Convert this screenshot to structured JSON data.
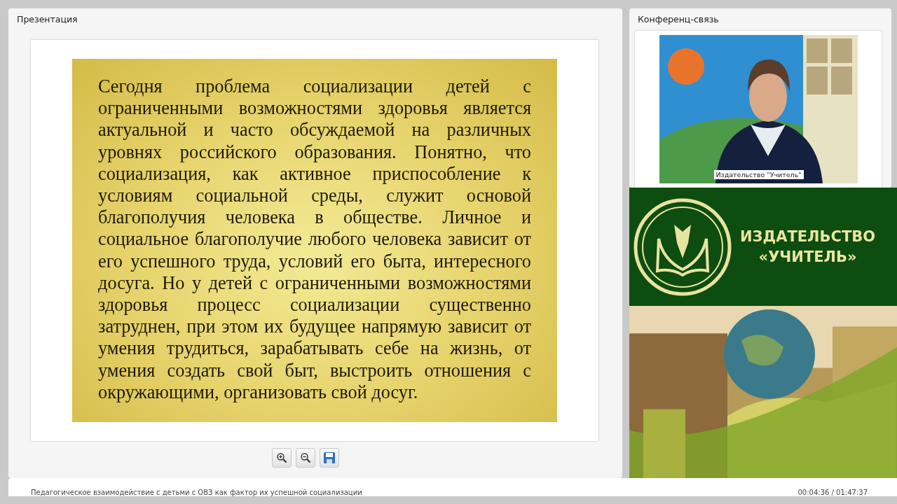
{
  "presentation": {
    "title": "Презентация",
    "slide_text": "Сегодня проблема социализации детей с ограниченными возможностями здоровья является актуальной и часто обсуждаемой на различных уровнях российского образования. Понятно, что социализация, как активное приспособление к условиям социальной среды, служит основой благополучия человека в обществе. Личное и социальное благополучие любого человека зависит от его успешного труда, условий его быта, интересного досуга. Но у детей с ограниченными возможностями здоровья процесс социализации существенно затруднен, при этом их будущее напрямую зависит от умения трудиться, зарабатывать себе на жизнь, от умения создать свой быт, выстроить отношения с окружающими, организовать свой досуг.",
    "tools": [
      {
        "kind": "zoom_in"
      },
      {
        "kind": "zoom_out"
      },
      {
        "kind": "save"
      }
    ]
  },
  "conference": {
    "title": "Конференц-связь",
    "video": {
      "kind": "picture",
      "caption": "Издательство \"Учитель\""
    }
  },
  "banner": {
    "line_1": "ИЗДАТЕЛЬСТВО",
    "line_2": "«УЧИТЕЛЬ»"
  },
  "status_bar": {
    "title": "Педагогическое взаимодействие с детьми с ОВЗ как фактор их успешной социализации",
    "time": "00:04:36 / 01:47:37"
  }
}
